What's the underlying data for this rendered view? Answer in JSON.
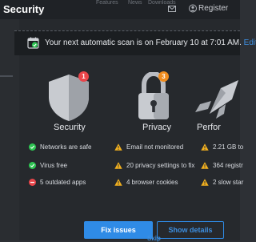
{
  "app": {
    "title": "Security"
  },
  "header": {
    "nav_cut": [
      "Features",
      "News",
      "Downloads"
    ],
    "register_label": "Register"
  },
  "banner": {
    "text": "Your next automatic scan is on February 10 at 7:01 AM.",
    "edit_label": "Edit"
  },
  "cards": [
    {
      "label": "Security",
      "badge": "1",
      "icon": "shield-icon"
    },
    {
      "label": "Privacy",
      "badge": "3",
      "icon": "lock-icon"
    },
    {
      "label": "Perfor",
      "icon": "rocket-icon"
    }
  ],
  "security_items": [
    {
      "text": "Networks are safe",
      "status": "ok"
    },
    {
      "text": "Virus free",
      "status": "ok"
    },
    {
      "text": "5 outdated apps",
      "status": "error"
    }
  ],
  "privacy_items": [
    {
      "text": "Email not monitored",
      "status": "warning"
    },
    {
      "text": "20 privacy settings to fix",
      "status": "warning"
    },
    {
      "text": "4 browser cookies",
      "status": "warning"
    }
  ],
  "performance_items": [
    {
      "text": "2.21 GB to",
      "status": "warning"
    },
    {
      "text": "364 registr",
      "status": "warning"
    },
    {
      "text": "2 slow star",
      "status": "warning"
    }
  ],
  "actions": {
    "fix_label": "Fix issues",
    "details_label": "Show details",
    "skip_label": "Skip"
  },
  "colors": {
    "accent": "#2f8be6",
    "ok": "#2ec452",
    "warning": "#f2b01e",
    "error": "#e8454a",
    "background": "#2d3035"
  }
}
